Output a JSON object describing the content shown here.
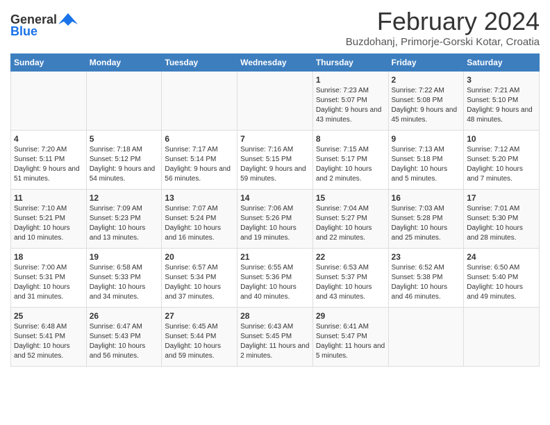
{
  "header": {
    "logo_general": "General",
    "logo_blue": "Blue",
    "month_year": "February 2024",
    "location": "Buzdohanj, Primorje-Gorski Kotar, Croatia"
  },
  "days_of_week": [
    "Sunday",
    "Monday",
    "Tuesday",
    "Wednesday",
    "Thursday",
    "Friday",
    "Saturday"
  ],
  "weeks": [
    [
      {
        "day": "",
        "sunrise": "",
        "sunset": "",
        "daylight": ""
      },
      {
        "day": "",
        "sunrise": "",
        "sunset": "",
        "daylight": ""
      },
      {
        "day": "",
        "sunrise": "",
        "sunset": "",
        "daylight": ""
      },
      {
        "day": "",
        "sunrise": "",
        "sunset": "",
        "daylight": ""
      },
      {
        "day": "1",
        "sunrise": "Sunrise: 7:23 AM",
        "sunset": "Sunset: 5:07 PM",
        "daylight": "Daylight: 9 hours and 43 minutes."
      },
      {
        "day": "2",
        "sunrise": "Sunrise: 7:22 AM",
        "sunset": "Sunset: 5:08 PM",
        "daylight": "Daylight: 9 hours and 45 minutes."
      },
      {
        "day": "3",
        "sunrise": "Sunrise: 7:21 AM",
        "sunset": "Sunset: 5:10 PM",
        "daylight": "Daylight: 9 hours and 48 minutes."
      }
    ],
    [
      {
        "day": "4",
        "sunrise": "Sunrise: 7:20 AM",
        "sunset": "Sunset: 5:11 PM",
        "daylight": "Daylight: 9 hours and 51 minutes."
      },
      {
        "day": "5",
        "sunrise": "Sunrise: 7:18 AM",
        "sunset": "Sunset: 5:12 PM",
        "daylight": "Daylight: 9 hours and 54 minutes."
      },
      {
        "day": "6",
        "sunrise": "Sunrise: 7:17 AM",
        "sunset": "Sunset: 5:14 PM",
        "daylight": "Daylight: 9 hours and 56 minutes."
      },
      {
        "day": "7",
        "sunrise": "Sunrise: 7:16 AM",
        "sunset": "Sunset: 5:15 PM",
        "daylight": "Daylight: 9 hours and 59 minutes."
      },
      {
        "day": "8",
        "sunrise": "Sunrise: 7:15 AM",
        "sunset": "Sunset: 5:17 PM",
        "daylight": "Daylight: 10 hours and 2 minutes."
      },
      {
        "day": "9",
        "sunrise": "Sunrise: 7:13 AM",
        "sunset": "Sunset: 5:18 PM",
        "daylight": "Daylight: 10 hours and 5 minutes."
      },
      {
        "day": "10",
        "sunrise": "Sunrise: 7:12 AM",
        "sunset": "Sunset: 5:20 PM",
        "daylight": "Daylight: 10 hours and 7 minutes."
      }
    ],
    [
      {
        "day": "11",
        "sunrise": "Sunrise: 7:10 AM",
        "sunset": "Sunset: 5:21 PM",
        "daylight": "Daylight: 10 hours and 10 minutes."
      },
      {
        "day": "12",
        "sunrise": "Sunrise: 7:09 AM",
        "sunset": "Sunset: 5:23 PM",
        "daylight": "Daylight: 10 hours and 13 minutes."
      },
      {
        "day": "13",
        "sunrise": "Sunrise: 7:07 AM",
        "sunset": "Sunset: 5:24 PM",
        "daylight": "Daylight: 10 hours and 16 minutes."
      },
      {
        "day": "14",
        "sunrise": "Sunrise: 7:06 AM",
        "sunset": "Sunset: 5:26 PM",
        "daylight": "Daylight: 10 hours and 19 minutes."
      },
      {
        "day": "15",
        "sunrise": "Sunrise: 7:04 AM",
        "sunset": "Sunset: 5:27 PM",
        "daylight": "Daylight: 10 hours and 22 minutes."
      },
      {
        "day": "16",
        "sunrise": "Sunrise: 7:03 AM",
        "sunset": "Sunset: 5:28 PM",
        "daylight": "Daylight: 10 hours and 25 minutes."
      },
      {
        "day": "17",
        "sunrise": "Sunrise: 7:01 AM",
        "sunset": "Sunset: 5:30 PM",
        "daylight": "Daylight: 10 hours and 28 minutes."
      }
    ],
    [
      {
        "day": "18",
        "sunrise": "Sunrise: 7:00 AM",
        "sunset": "Sunset: 5:31 PM",
        "daylight": "Daylight: 10 hours and 31 minutes."
      },
      {
        "day": "19",
        "sunrise": "Sunrise: 6:58 AM",
        "sunset": "Sunset: 5:33 PM",
        "daylight": "Daylight: 10 hours and 34 minutes."
      },
      {
        "day": "20",
        "sunrise": "Sunrise: 6:57 AM",
        "sunset": "Sunset: 5:34 PM",
        "daylight": "Daylight: 10 hours and 37 minutes."
      },
      {
        "day": "21",
        "sunrise": "Sunrise: 6:55 AM",
        "sunset": "Sunset: 5:36 PM",
        "daylight": "Daylight: 10 hours and 40 minutes."
      },
      {
        "day": "22",
        "sunrise": "Sunrise: 6:53 AM",
        "sunset": "Sunset: 5:37 PM",
        "daylight": "Daylight: 10 hours and 43 minutes."
      },
      {
        "day": "23",
        "sunrise": "Sunrise: 6:52 AM",
        "sunset": "Sunset: 5:38 PM",
        "daylight": "Daylight: 10 hours and 46 minutes."
      },
      {
        "day": "24",
        "sunrise": "Sunrise: 6:50 AM",
        "sunset": "Sunset: 5:40 PM",
        "daylight": "Daylight: 10 hours and 49 minutes."
      }
    ],
    [
      {
        "day": "25",
        "sunrise": "Sunrise: 6:48 AM",
        "sunset": "Sunset: 5:41 PM",
        "daylight": "Daylight: 10 hours and 52 minutes."
      },
      {
        "day": "26",
        "sunrise": "Sunrise: 6:47 AM",
        "sunset": "Sunset: 5:43 PM",
        "daylight": "Daylight: 10 hours and 56 minutes."
      },
      {
        "day": "27",
        "sunrise": "Sunrise: 6:45 AM",
        "sunset": "Sunset: 5:44 PM",
        "daylight": "Daylight: 10 hours and 59 minutes."
      },
      {
        "day": "28",
        "sunrise": "Sunrise: 6:43 AM",
        "sunset": "Sunset: 5:45 PM",
        "daylight": "Daylight: 11 hours and 2 minutes."
      },
      {
        "day": "29",
        "sunrise": "Sunrise: 6:41 AM",
        "sunset": "Sunset: 5:47 PM",
        "daylight": "Daylight: 11 hours and 5 minutes."
      },
      {
        "day": "",
        "sunrise": "",
        "sunset": "",
        "daylight": ""
      },
      {
        "day": "",
        "sunrise": "",
        "sunset": "",
        "daylight": ""
      }
    ]
  ]
}
